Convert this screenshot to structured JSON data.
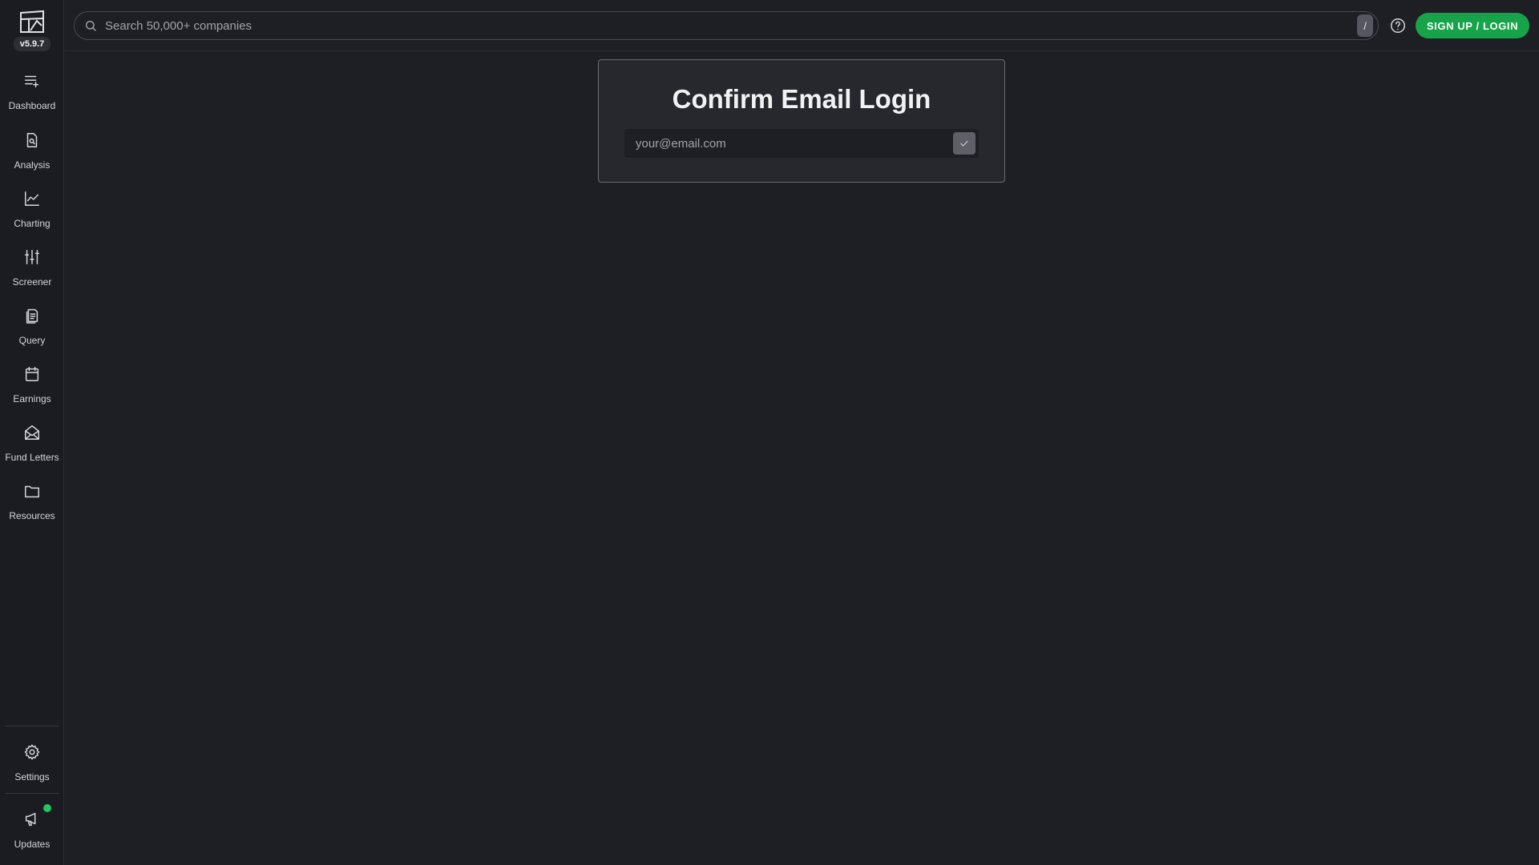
{
  "app": {
    "version": "v5.9.7"
  },
  "sidebar": {
    "items": [
      {
        "label": "Dashboard",
        "icon": "dashboard-icon"
      },
      {
        "label": "Analysis",
        "icon": "analysis-document-icon"
      },
      {
        "label": "Charting",
        "icon": "line-chart-icon"
      },
      {
        "label": "Screener",
        "icon": "sliders-icon"
      },
      {
        "label": "Query",
        "icon": "query-document-icon"
      },
      {
        "label": "Earnings",
        "icon": "calendar-icon"
      },
      {
        "label": "Fund Letters",
        "icon": "envelope-open-icon"
      },
      {
        "label": "Resources",
        "icon": "folder-icon"
      }
    ],
    "bottom_items": [
      {
        "label": "Settings",
        "icon": "gear-icon"
      },
      {
        "label": "Updates",
        "icon": "megaphone-icon",
        "has_notification": true
      }
    ]
  },
  "header": {
    "search_placeholder": "Search 50,000+ companies",
    "search_shortcut": "/",
    "help_icon": "help-circle-icon",
    "signup_label": "SIGN UP / LOGIN"
  },
  "card": {
    "title": "Confirm Email Login",
    "email_placeholder": "your@email.com",
    "confirm_icon": "check-icon"
  },
  "colors": {
    "background": "#1e1f24",
    "sidebar": "#1b1c21",
    "card": "#27282e",
    "accent_green": "#16a34a",
    "notification_dot": "#22c55e"
  }
}
